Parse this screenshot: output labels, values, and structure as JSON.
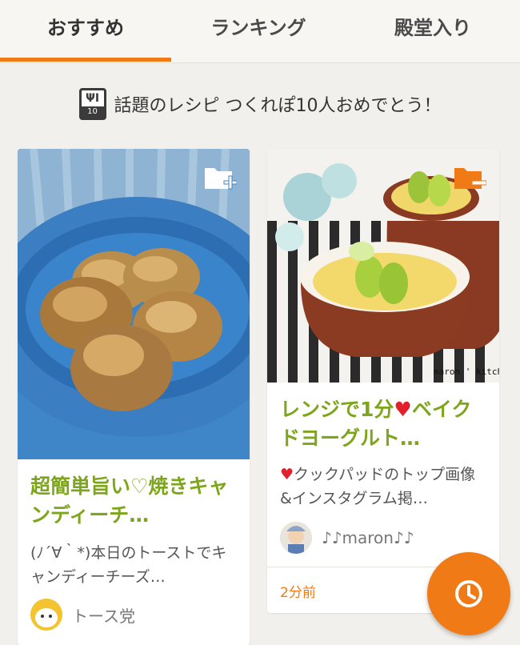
{
  "tabs": [
    {
      "label": "おすすめ",
      "active": true
    },
    {
      "label": "ランキング",
      "active": false
    },
    {
      "label": "殿堂入り",
      "active": false
    }
  ],
  "headline": {
    "badge_number": "10",
    "text": "話題のレシピ つくれぽ10人おめでとう！"
  },
  "cards": [
    {
      "title": "超簡単旨い♡焼きキャンディーチ…",
      "description": "(ﾉ´∀｀*)本日のトーストでキャンディーチーズ…",
      "author": "トース党",
      "folder_icon": "folder-add-icon"
    },
    {
      "title_before_heart": "レンジで1分",
      "title_heart": "♥",
      "title_after_heart": "ベイクドヨーグルト…",
      "description_heart": "♥",
      "description": "クックパッドのトップ画像&インスタグラム掲…",
      "author": "♪♪maron♪♪",
      "time": "2分前",
      "photo_watermark": "maron ' kitchen",
      "folder_icon": "folder-saved-icon"
    }
  ],
  "fab": {
    "icon": "clock-icon"
  },
  "colors": {
    "accent": "#f07a16",
    "title_green": "#7ea61c",
    "heart_red": "#e0202c",
    "background": "#f2f0ec"
  }
}
